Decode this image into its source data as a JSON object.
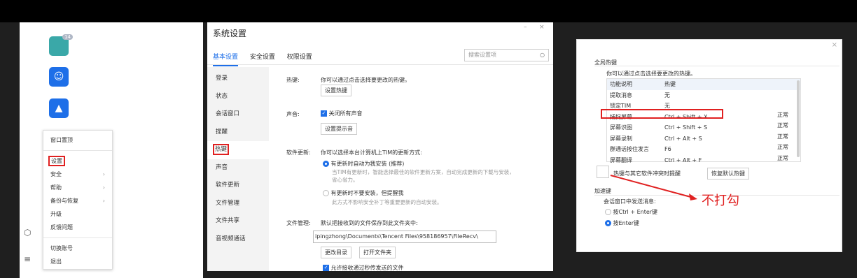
{
  "left_panel": {
    "badge": "14",
    "menu_items": [
      {
        "label": "窗口置顶",
        "arrow": ""
      },
      {
        "label": "设置",
        "arrow": ""
      },
      {
        "label": "安全",
        "arrow": "›"
      },
      {
        "label": "帮助",
        "arrow": "›"
      },
      {
        "label": "备份与恢复",
        "arrow": "›"
      },
      {
        "label": "升级",
        "arrow": ""
      },
      {
        "label": "反馈问题",
        "arrow": ""
      },
      {
        "label": "切换账号",
        "arrow": ""
      },
      {
        "label": "退出",
        "arrow": ""
      }
    ]
  },
  "settings": {
    "title": "系统设置",
    "window_controls": [
      "–",
      "×"
    ],
    "tabs": [
      "基本设置",
      "安全设置",
      "权限设置"
    ],
    "search_placeholder": "搜索设置项",
    "nav": [
      "登录",
      "状态",
      "会话窗口",
      "提醒",
      "热键",
      "声音",
      "软件更新",
      "文件管理",
      "文件共享",
      "音视频通话"
    ],
    "hotkey_label": "热键:",
    "hotkey_desc": "你可以通过点击选择要更改的热键。",
    "hotkey_button": "设置热键",
    "sound_label": "声音:",
    "sound_checkbox": "关闭所有声音",
    "sound_button": "设置提示音",
    "update_label": "软件更新:",
    "update_desc": "你可以选择本台计算机上TIM的更新方式:",
    "update_opt1": "有更新时自动为我安装 (推荐)",
    "update_opt1_desc": "当TIM有更新时，智能选择最佳的软件更新方案，自动完成更新的下载与安装，省心省力。",
    "update_opt2": "有更新时不要安装，但提醒我",
    "update_opt2_desc": "此方式不影响安全补丁等重要更新的自动安装。",
    "file_label": "文件管理:",
    "file_desc": "默认把接收到的文件保存到此文件夹中:",
    "file_path": "ipingzhong\\Documents\\Tencent Files\\958186957\\FileRecv\\",
    "file_btn1": "更改目录",
    "file_btn2": "打开文件夹",
    "file_checkbox": "允许接收通过秒传发送的文件"
  },
  "hotkeys": {
    "close": "×",
    "section_title": "全局热键",
    "desc": "你可以通过点击选择要更改的热键。",
    "col1": "功能说明",
    "col2": "热键",
    "rows": [
      {
        "name": "提取消息",
        "key": "无",
        "status": ""
      },
      {
        "name": "锁定TIM",
        "key": "无",
        "status": ""
      },
      {
        "name": "捕捉屏幕",
        "key": "Ctrl + Shift + X",
        "status": "正常"
      },
      {
        "name": "屏幕识图",
        "key": "Ctrl + Shift + S",
        "status": "正常"
      },
      {
        "name": "屏幕录制",
        "key": "Ctrl + Alt + S",
        "status": "正常"
      },
      {
        "name": "群通话按住发言",
        "key": "F6",
        "status": "正常"
      },
      {
        "name": "屏幕翻译",
        "key": "Ctrl + Alt + F",
        "status": "正常"
      }
    ],
    "conflict_checkbox": "热键与其它软件冲突时提醒",
    "restore_button": "恢复默认热键",
    "accel_title": "加速键",
    "send_label": "会话窗口中发送消息:",
    "send_opt1": "按Ctrl + Enter键",
    "send_opt2": "按Enter键",
    "annotation": "不打勾"
  }
}
